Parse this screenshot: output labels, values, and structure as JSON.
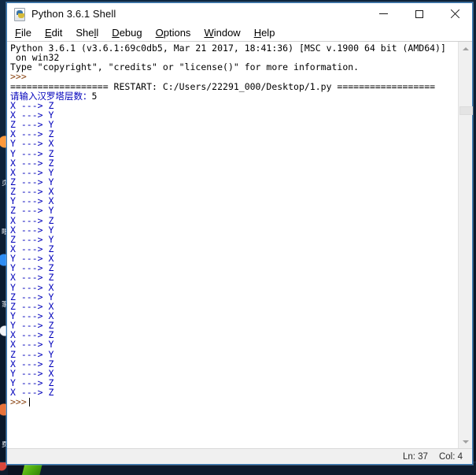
{
  "window": {
    "title": "Python 3.6.1 Shell",
    "icon": "python-idle-icon",
    "controls": {
      "minimize": "—",
      "maximize": "□",
      "close": "✕"
    }
  },
  "menubar": {
    "items": [
      {
        "label": "File",
        "accel": "F"
      },
      {
        "label": "Edit",
        "accel": "E"
      },
      {
        "label": "Shell",
        "accel": "l"
      },
      {
        "label": "Debug",
        "accel": "D"
      },
      {
        "label": "Options",
        "accel": "O"
      },
      {
        "label": "Window",
        "accel": "W"
      },
      {
        "label": "Help",
        "accel": "H"
      }
    ]
  },
  "shell": {
    "banner": [
      "Python 3.6.1 (v3.6.1:69c0db5, Mar 21 2017, 18:41:36) [MSC v.1900 64 bit (AMD64)]",
      " on win32",
      "Type \"copyright\", \"credits\" or \"license()\" for more information."
    ],
    "prompt": ">>>",
    "restart_line": "================== RESTART: C:/Users/22291_000/Desktop/1.py ==================",
    "input_prompt": "请输入汉罗塔层数：",
    "input_value": "5",
    "moves": [
      "X ---> Z",
      "X ---> Y",
      "Z ---> Y",
      "X ---> Z",
      "Y ---> X",
      "Y ---> Z",
      "X ---> Z",
      "X ---> Y",
      "Z ---> Y",
      "Z ---> X",
      "Y ---> X",
      "Z ---> Y",
      "X ---> Z",
      "X ---> Y",
      "Z ---> Y",
      "X ---> Z",
      "Y ---> X",
      "Y ---> Z",
      "X ---> Z",
      "Y ---> X",
      "Z ---> Y",
      "Z ---> X",
      "Y ---> X",
      "Y ---> Z",
      "X ---> Z",
      "X ---> Y",
      "Z ---> Y",
      "X ---> Z",
      "Y ---> X",
      "Y ---> Z",
      "X ---> Z"
    ],
    "final_prompt": ">>>"
  },
  "statusbar": {
    "line_label": "Ln: 37",
    "col_label": "Col: 4"
  },
  "scrollbar": {
    "up_arrow": "chevron-up",
    "down_arrow": "chevron-down"
  },
  "desktop": {
    "labels": [
      "页",
      "眼",
      "家",
      "费"
    ]
  },
  "colors": {
    "stdout": "#0000bb",
    "prompt": "#8b4513",
    "window_border": "#3a7cb8",
    "statusbar_bg": "#f0f0f0"
  }
}
